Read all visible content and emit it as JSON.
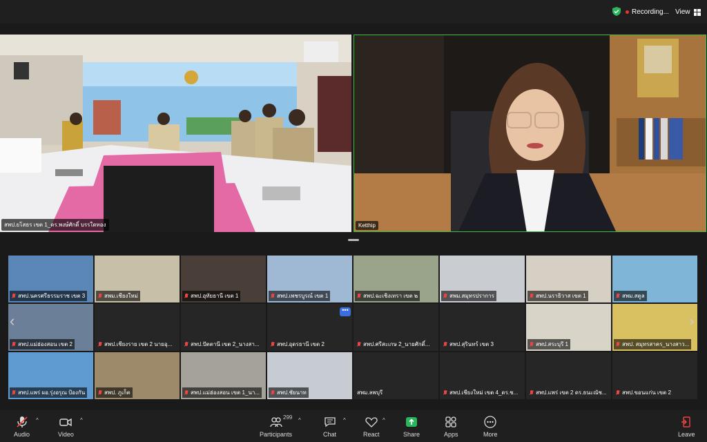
{
  "topbar": {
    "recording": "Recording...",
    "view": "View"
  },
  "speakers": [
    {
      "name": "สพป.ยโสธร เขต 1_ดร.พงษ์ศักดิ์ บรรใดทอง"
    },
    {
      "name": "Ketthip"
    }
  ],
  "gallery": {
    "row1": [
      "สพป.นครศรีธรรมราช เขต 3",
      "สพม.เชียงใหม่",
      "สพป.อุทัยธานี เขต 1",
      "สพป.เพชรบูรณ์ เขต 1",
      "สพป.ฉะเชิงเทรา เขต ๒",
      "สพม.สมุทรปราการ",
      "สพป.นราธิวาส เขต 1",
      "สพม.สตูล"
    ],
    "row2": [
      "สพป.แม่ฮ่องสอน เขต 2",
      "สพป.เชียงราย เขต 2 นายอุ...",
      "สพป.ปัตตานี เขต 2_นางสา...",
      "สพป.อุดรธานี เขต 2",
      "สพป.ศรีสะเกษ 2_นายศักดิ์...",
      "สพป.สุรินทร์ เขต 3",
      "สพป.สระบุรี 1",
      "สพป. สมุทรสาคร_นางสาว..."
    ],
    "row3": [
      "สพป.แพร่ ผอ.รุ่งอรุณ ป้องกัน",
      "สพป. ภูเก็ต",
      "สพป.แม่ฮ่องสอน เขต 1_นา...",
      "สพป.ชัยนาท",
      "สพม.ลพบุรี",
      "สพป.เชียงใหม่ เขต 4_ดร.ช...",
      "สพป.แพร่ เขต 2 ดร.ธนะณัช...",
      "สพป.ขอนแก่น เขต 2"
    ],
    "more": "•••"
  },
  "toolbar": {
    "audio": "Audio",
    "video": "Video",
    "participants": "Participants",
    "participants_count": "299",
    "chat": "Chat",
    "react": "React",
    "share": "Share",
    "apps": "Apps",
    "more": "More",
    "leave": "Leave"
  },
  "colors": {
    "share": "#2db55d",
    "active_speaker_border": "#3fbf3f",
    "muted": "#e44444"
  }
}
